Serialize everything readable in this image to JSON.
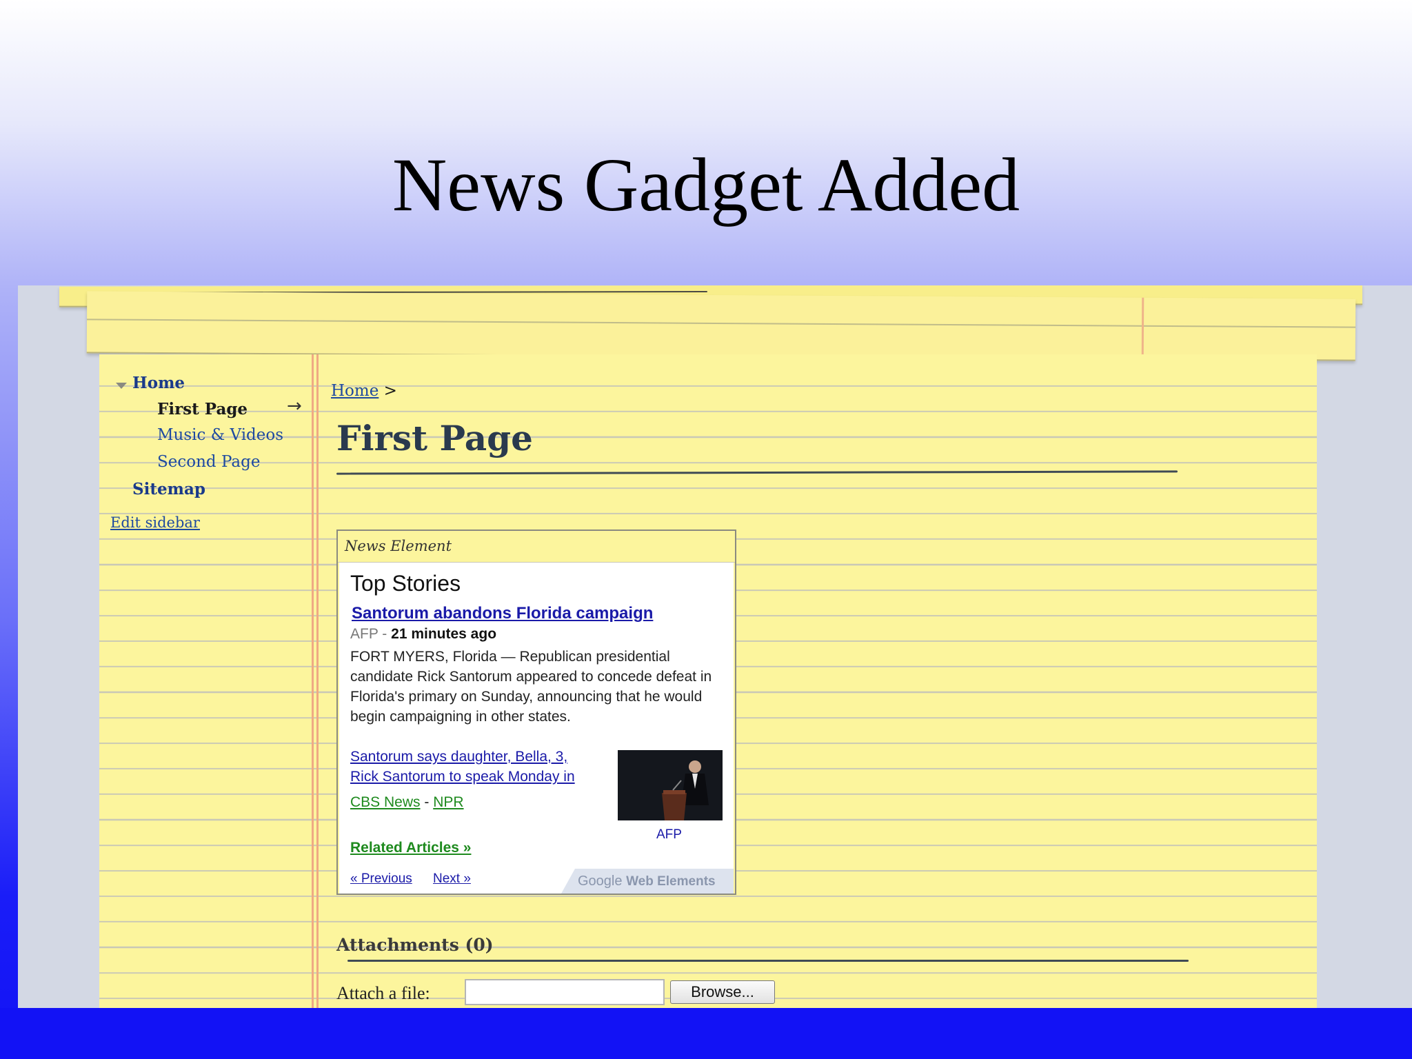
{
  "slide": {
    "title": "News Gadget Added"
  },
  "sidebar": {
    "home": "Home",
    "items": [
      "First Page",
      "Music & Videos",
      "Second Page"
    ],
    "sitemap": "Sitemap",
    "edit": "Edit sidebar"
  },
  "main": {
    "breadcrumb_link": "Home",
    "breadcrumb_sep": ">",
    "page_title": "First Page"
  },
  "gadget": {
    "header": "News Element",
    "top_stories": "Top Stories",
    "headline": "Santorum abandons Florida campaign",
    "source": "AFP",
    "separator": " - ",
    "time": "21 minutes ago",
    "text": "FORT MYERS, Florida — Republican presidential candidate Rick Santorum appeared to concede defeat in Florida's primary on Sunday, announcing that he would begin campaigning in other states.",
    "related": [
      "Santorum says daughter, Bella, 3,",
      "Rick Santorum to speak Monday in"
    ],
    "sources": [
      "CBS News",
      "NPR"
    ],
    "sources_sep": " - ",
    "photo_caption": "AFP",
    "related_articles": "Related Articles »",
    "prev": "« Previous",
    "next": "Next »",
    "brand_google": "Google",
    "brand_rest": "Web Elements"
  },
  "attachments": {
    "heading": "Attachments (0)",
    "label": "Attach a file:",
    "browse": "Browse..."
  }
}
